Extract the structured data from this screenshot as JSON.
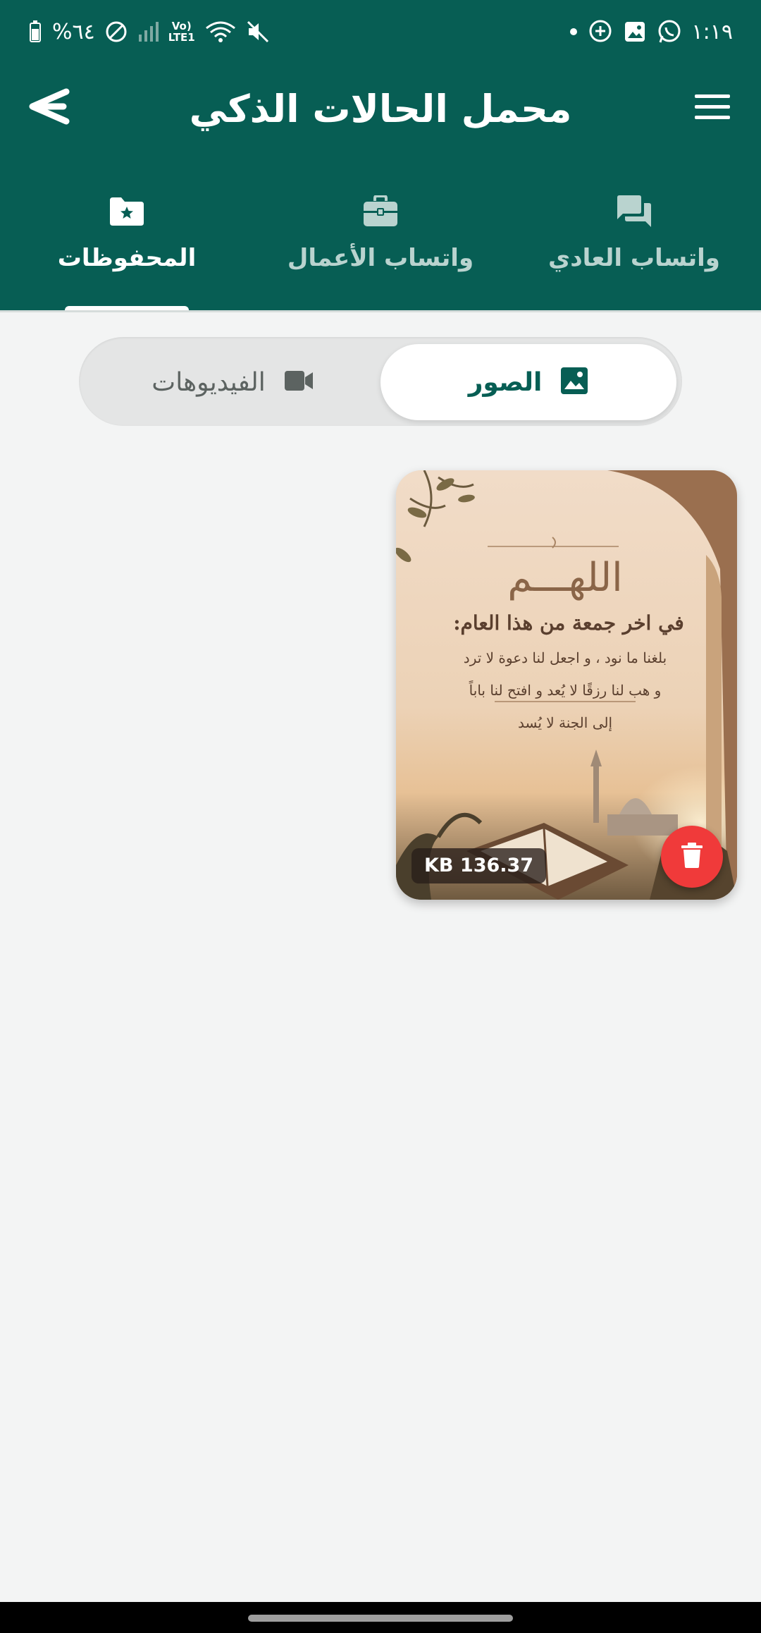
{
  "status_bar": {
    "time": "١:١٩",
    "battery_text": "%٦٤",
    "network_label_top": "Vo)",
    "network_label_bottom": "LTE1",
    "icons": [
      "whatsapp-icon",
      "gallery-icon",
      "add-chat-icon",
      "dot-icon",
      "mute-icon",
      "wifi-icon",
      "signal-icon",
      "dnd-icon",
      "battery-icon"
    ]
  },
  "app_bar": {
    "title": "محمل الحالات الذكي",
    "back_icon": "back-arrow-icon",
    "menu_icon": "hamburger-menu-icon"
  },
  "tabs": [
    {
      "label": "المحفوظات",
      "icon": "saved-folder-star-icon",
      "active": true
    },
    {
      "label": "واتساب الأعمال",
      "icon": "briefcase-icon",
      "active": false
    },
    {
      "label": "واتساب العادي",
      "icon": "chat-bubbles-icon",
      "active": false
    }
  ],
  "media_toggle": {
    "images_label": "الصور",
    "videos_label": "الفيديوهات",
    "selected": "images"
  },
  "saved_items": [
    {
      "type": "image",
      "size_label": "KB 136.37",
      "image_text": {
        "title": "اللهـــم",
        "subtitle": "في اخر جمعة من هذا العام:",
        "line1": "بلغنا ما نود ، و اجعل لنا دعوة لا ترد",
        "line2": "و هب لنا رزقًا لا يُعد و افتح لنا باباً",
        "line3": "إلى الجنة لا يُسد"
      }
    }
  ],
  "colors": {
    "primary": "#075e54",
    "background": "#f3f4f4",
    "delete": "#f03a3a",
    "tab_inactive": "#b9d3cf"
  }
}
